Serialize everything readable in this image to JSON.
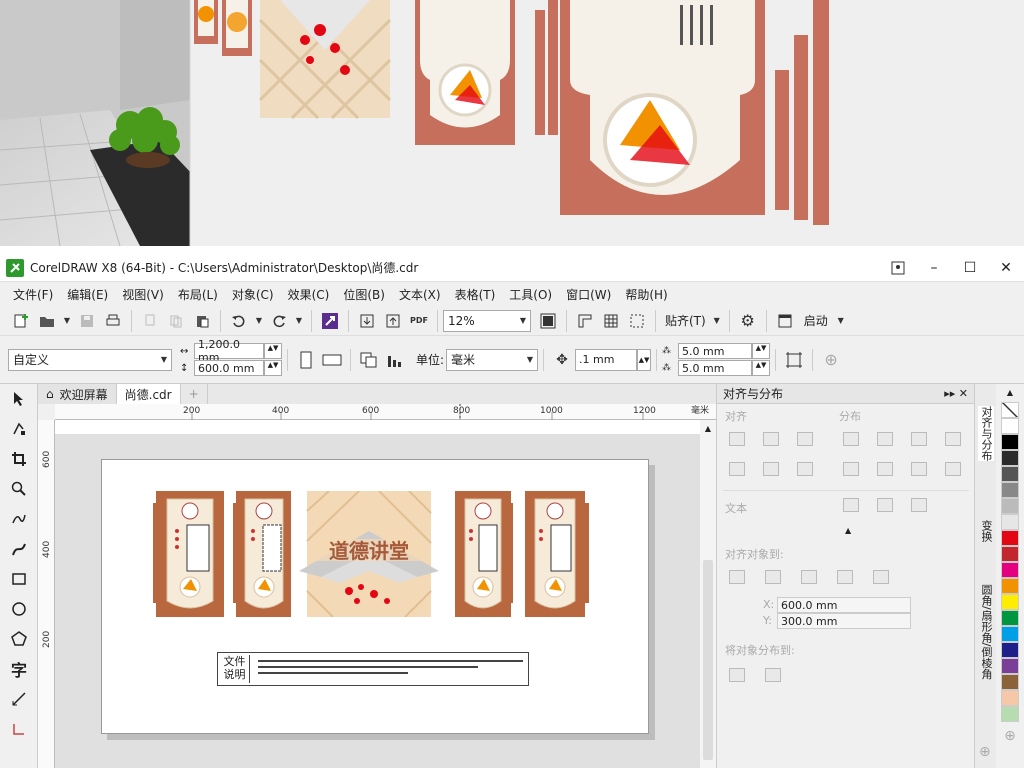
{
  "window": {
    "title": "CorelDRAW X8 (64-Bit) - C:\\Users\\Administrator\\Desktop\\尚德.cdr"
  },
  "menu": [
    "文件(F)",
    "编辑(E)",
    "视图(V)",
    "布局(L)",
    "对象(C)",
    "效果(C)",
    "位图(B)",
    "文本(X)",
    "表格(T)",
    "工具(O)",
    "窗口(W)",
    "帮助(H)"
  ],
  "toolbar": {
    "zoom": "12%",
    "snap_label": "贴齐(T)",
    "launch_label": "启动"
  },
  "property_bar": {
    "preset": "自定义",
    "width": "1,200.0 mm",
    "height": "600.0 mm",
    "unit_label": "单位:",
    "unit": "毫米",
    "nudge": ".1 mm",
    "dup_x": "5.0 mm",
    "dup_y": "5.0 mm"
  },
  "tabs": {
    "welcome": "欢迎屏幕",
    "doc": "尚德.cdr"
  },
  "ruler": {
    "h_ticks": [
      "200",
      "400",
      "600",
      "800",
      "1000",
      "1200"
    ],
    "h_unit": "毫米",
    "v_ticks": [
      "600",
      "400",
      "200"
    ]
  },
  "artwork": {
    "center_title": "道德讲堂",
    "note_line1": "文件",
    "note_line2": "说明"
  },
  "docker": {
    "title": "对齐与分布",
    "align": "对齐",
    "distribute": "分布",
    "text": "文本",
    "align_to": "对齐对象到:",
    "x": "600.0 mm",
    "y": "300.0 mm",
    "distribute_to": "将对象分布到:"
  },
  "side_tabs": [
    "对齐与分布",
    "变换",
    "圆角/扇形角/倒棱角"
  ],
  "palette_colors": [
    "#ffffff",
    "#000000",
    "#e30613",
    "#f39200",
    "#ffed00",
    "#009640",
    "#00a0e9",
    "#1d2088",
    "#e4007f",
    "#2f4f6f",
    "#b48060",
    "#7cc576",
    "#f7c8a8",
    "#ffffff"
  ]
}
